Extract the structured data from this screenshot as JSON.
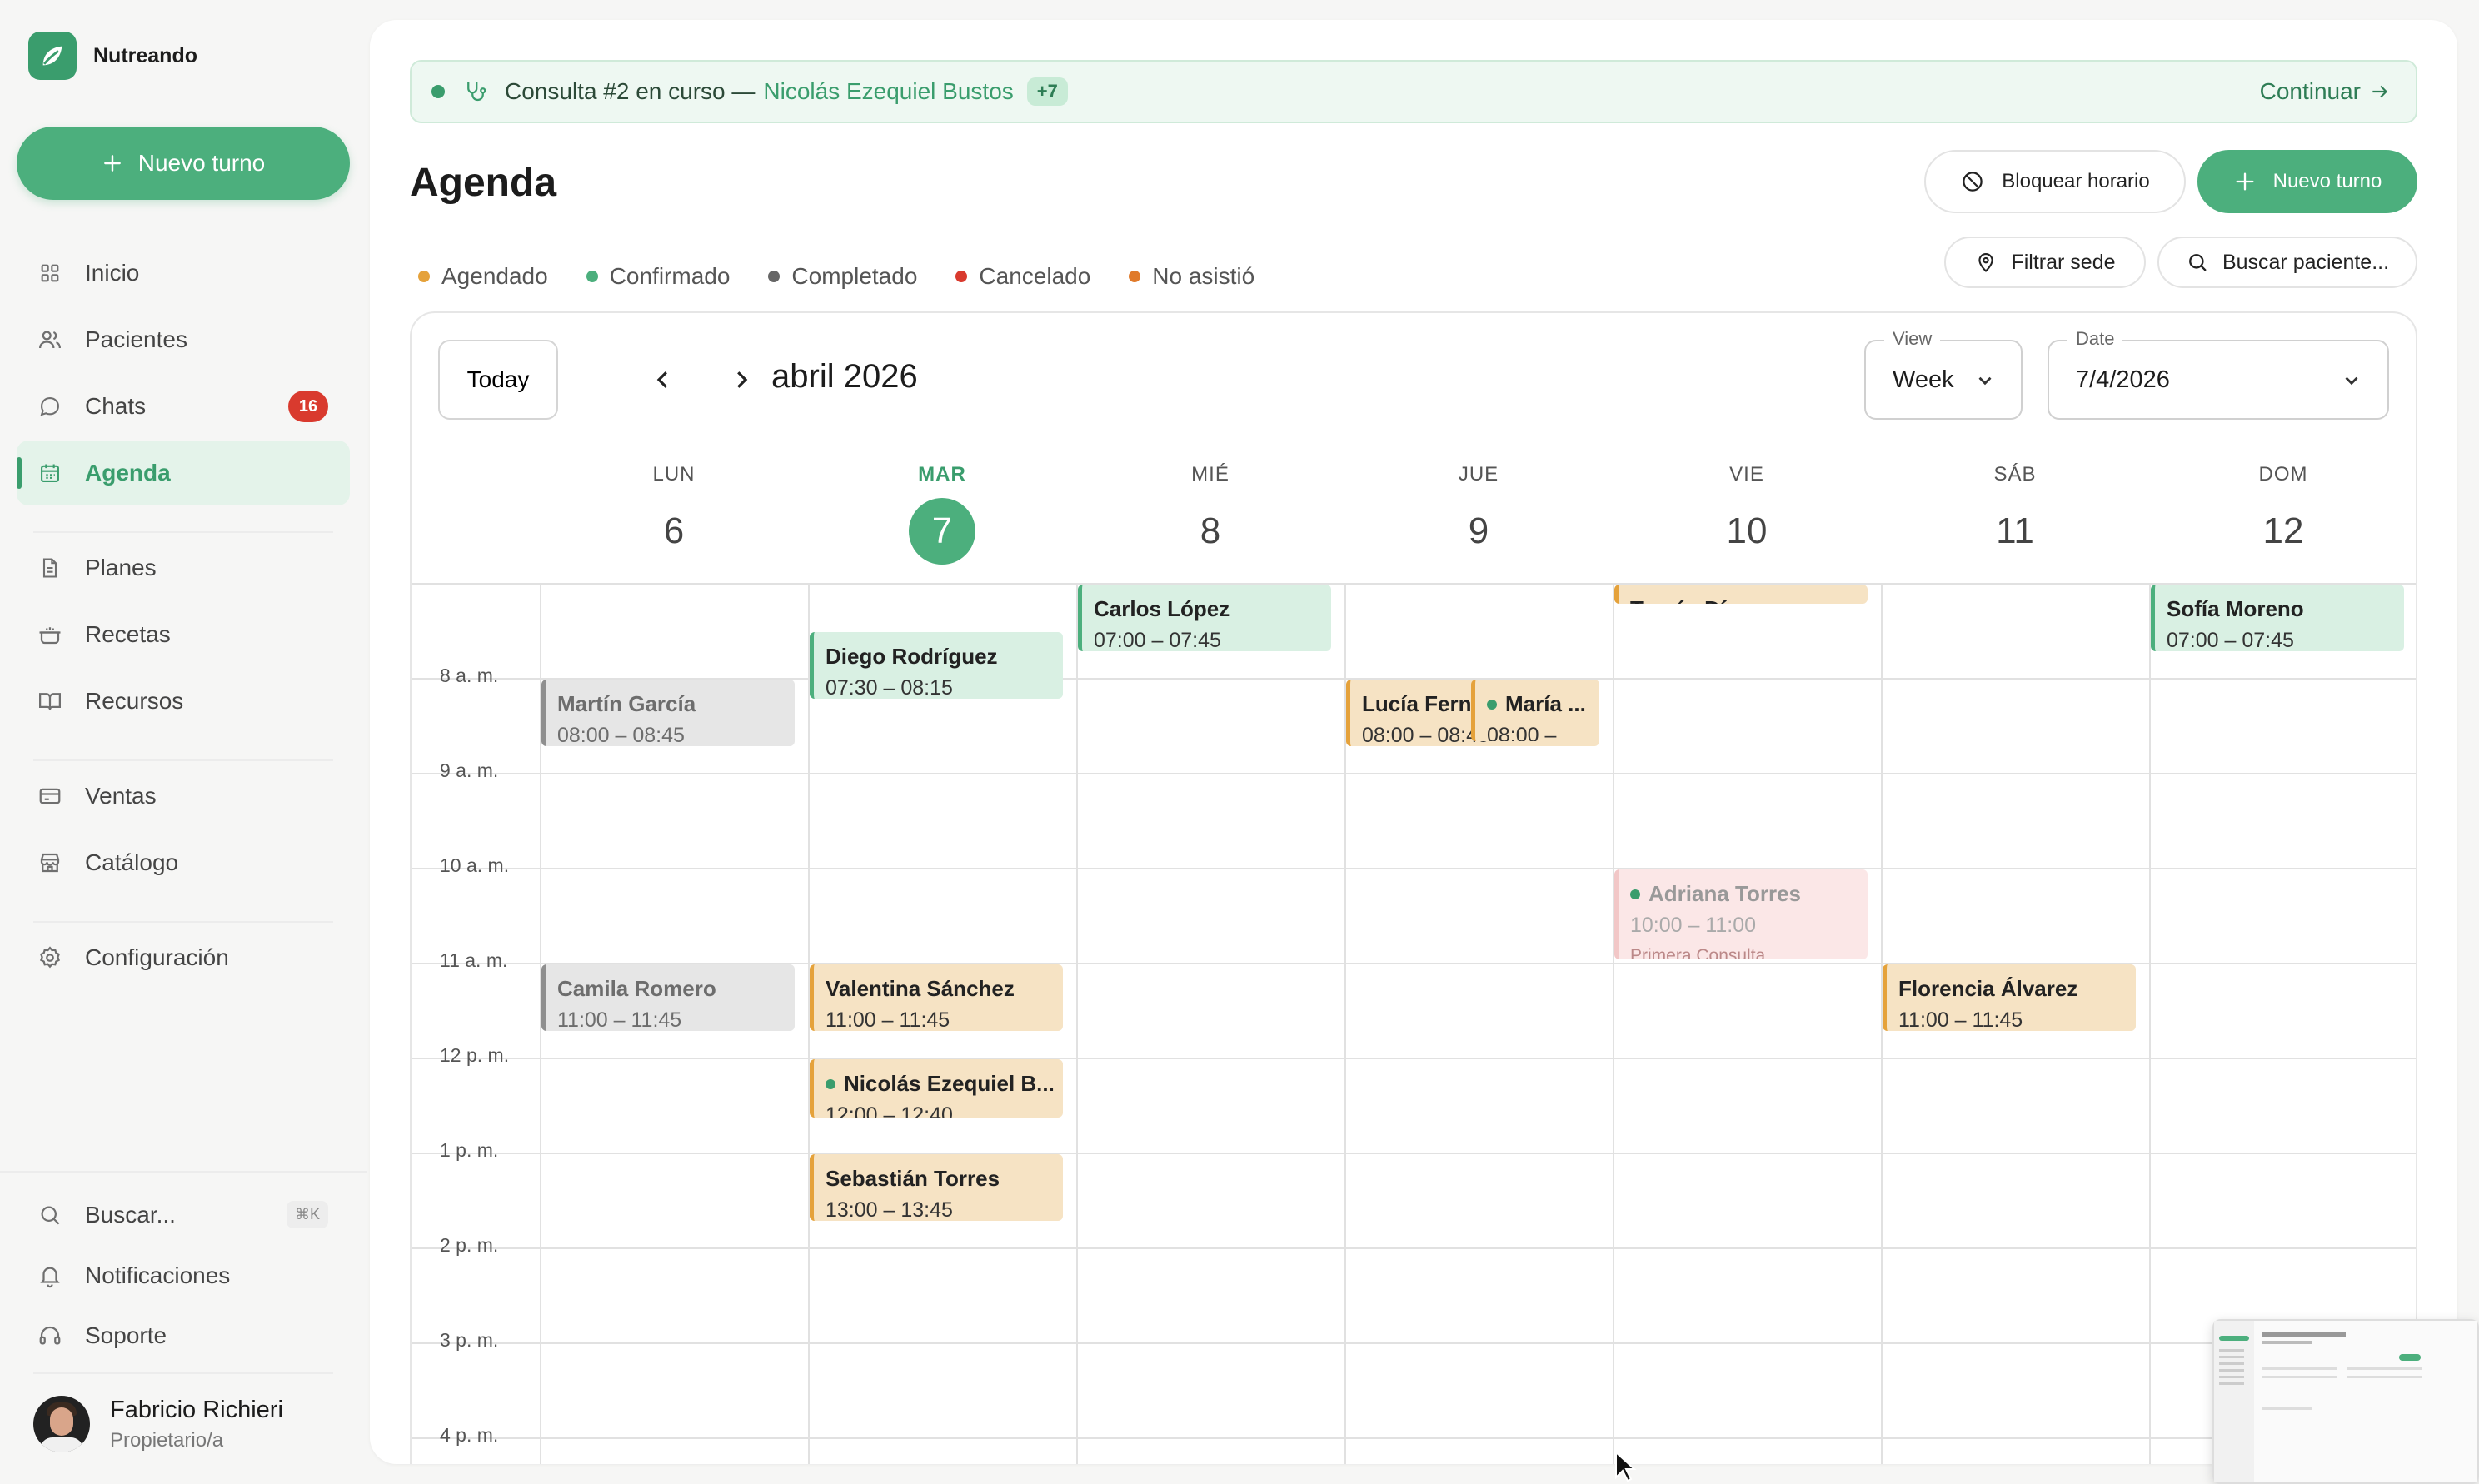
{
  "brand": {
    "name": "Nutreando"
  },
  "sidebar": {
    "new_label": "Nuevo turno",
    "items": [
      {
        "label": "Inicio",
        "icon": "grid-icon"
      },
      {
        "label": "Pacientes",
        "icon": "users-icon"
      },
      {
        "label": "Chats",
        "icon": "chat-icon",
        "badge": "16"
      },
      {
        "label": "Agenda",
        "icon": "calendar-icon",
        "active": true
      },
      {
        "label": "Planes",
        "icon": "document-icon"
      },
      {
        "label": "Recetas",
        "icon": "pot-icon"
      },
      {
        "label": "Recursos",
        "icon": "book-icon"
      },
      {
        "label": "Ventas",
        "icon": "card-icon"
      },
      {
        "label": "Catálogo",
        "icon": "store-icon"
      },
      {
        "label": "Configuración",
        "icon": "gear-icon"
      }
    ],
    "bottom": [
      {
        "label": "Buscar...",
        "icon": "search-icon",
        "kbd": "⌘K"
      },
      {
        "label": "Notificaciones",
        "icon": "bell-icon"
      },
      {
        "label": "Soporte",
        "icon": "headset-icon"
      }
    ],
    "user": {
      "name": "Fabricio Richieri",
      "role": "Propietario/a"
    }
  },
  "banner": {
    "text": "Consulta #2 en curso —",
    "patient": "Nicolás Ezequiel Bustos",
    "chip": "+7",
    "action": "Continuar"
  },
  "page": {
    "title": "Agenda",
    "block_label": "Bloquear horario",
    "new_label": "Nuevo turno",
    "filter_label": "Filtrar sede",
    "search_label": "Buscar paciente..."
  },
  "legend": [
    {
      "label": "Agendado",
      "color": "#e5a23b"
    },
    {
      "label": "Confirmado",
      "color": "#4caf7d"
    },
    {
      "label": "Completado",
      "color": "#666666"
    },
    {
      "label": "Cancelado",
      "color": "#d93a2e"
    },
    {
      "label": "No asistió",
      "color": "#e07a2a"
    }
  ],
  "calendar": {
    "today_label": "Today",
    "month": "abril 2026",
    "view": {
      "label": "View",
      "value": "Week"
    },
    "date": {
      "label": "Date",
      "value": "7/4/2026"
    },
    "days": [
      {
        "name": "LUN",
        "num": "6"
      },
      {
        "name": "MAR",
        "num": "7",
        "today": true
      },
      {
        "name": "MIÉ",
        "num": "8"
      },
      {
        "name": "JUE",
        "num": "9"
      },
      {
        "name": "VIE",
        "num": "10"
      },
      {
        "name": "SÁB",
        "num": "11"
      },
      {
        "name": "DOM",
        "num": "12"
      }
    ],
    "hours": [
      "8 a. m.",
      "9 a. m.",
      "10 a. m.",
      "11 a. m.",
      "12 p. m.",
      "1 p. m.",
      "2 p. m.",
      "3 p. m.",
      "4 p. m."
    ],
    "events": [
      {
        "day": 0,
        "start": 8.0,
        "end": 8.75,
        "name": "Martín García",
        "time": "08:00 – 08:45",
        "status": "gray"
      },
      {
        "day": 0,
        "start": 11.0,
        "end": 11.75,
        "name": "Camila Romero",
        "time": "11:00 – 11:45",
        "status": "gray"
      },
      {
        "day": 1,
        "start": 7.5,
        "end": 8.25,
        "name": "Diego Rodríguez",
        "time": "07:30 – 08:15",
        "status": "green"
      },
      {
        "day": 1,
        "start": 11.0,
        "end": 11.75,
        "name": "Valentina Sánchez",
        "time": "11:00 – 11:45",
        "status": "orange"
      },
      {
        "day": 1,
        "start": 12.0,
        "end": 12.67,
        "name": "Nicolás Ezequiel B...",
        "time": "12:00 – 12:40",
        "status": "orange",
        "dot": true
      },
      {
        "day": 1,
        "start": 13.0,
        "end": 13.75,
        "name": "Sebastián Torres",
        "time": "13:00 – 13:45",
        "status": "orange"
      },
      {
        "day": 2,
        "start": 7.0,
        "end": 7.75,
        "name": "Carlos López",
        "time": "07:00 – 07:45",
        "status": "green"
      },
      {
        "day": 3,
        "start": 8.0,
        "end": 8.75,
        "name": "Lucía Fernández",
        "time": "08:00 – 08:45",
        "status": "orange"
      },
      {
        "day": 3,
        "start": 8.0,
        "end": 8.7,
        "name": "María ...",
        "time": "08:00 –",
        "status": "orange",
        "dot": true,
        "half": true
      },
      {
        "day": 4,
        "start": 7.0,
        "end": 7.25,
        "name": "Tomás Díaz",
        "time": "",
        "status": "orange"
      },
      {
        "day": 4,
        "start": 10.0,
        "end": 11.0,
        "name": "Adriana Torres",
        "time": "10:00 – 11:00",
        "sub": "Primera Consulta",
        "status": "pink",
        "dot": true
      },
      {
        "day": 5,
        "start": 11.0,
        "end": 11.75,
        "name": "Florencia Álvarez",
        "time": "11:00 – 11:45",
        "status": "orange"
      },
      {
        "day": 6,
        "start": 7.0,
        "end": 7.75,
        "name": "Sofía Moreno",
        "time": "07:00 – 07:45",
        "status": "green"
      }
    ]
  }
}
